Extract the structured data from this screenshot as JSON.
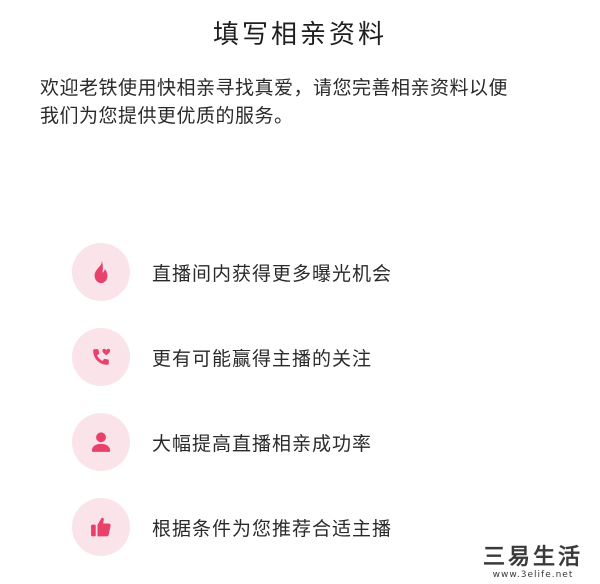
{
  "header": {
    "title": "填写相亲资料"
  },
  "intro": {
    "line1": "欢迎老铁使用快相亲寻找真爱，请您完善相亲资料以便",
    "line2": "我们为您提供更优质的服务。"
  },
  "benefits": [
    {
      "icon": "flame-icon",
      "label": "直播间内获得更多曝光机会"
    },
    {
      "icon": "phone-heart-icon",
      "label": "更有可能赢得主播的关注"
    },
    {
      "icon": "person-icon",
      "label": "大幅提高直播相亲成功率"
    },
    {
      "icon": "thumbs-up-icon",
      "label": "根据条件为您推荐合适主播"
    }
  ],
  "watermark": {
    "main": "三易生活",
    "sub": "www.3elife.net"
  },
  "colors": {
    "accent": "#e8416b",
    "icon_background": "#fbe3ea",
    "text": "#2a2a2a",
    "background": "#ffffff"
  }
}
